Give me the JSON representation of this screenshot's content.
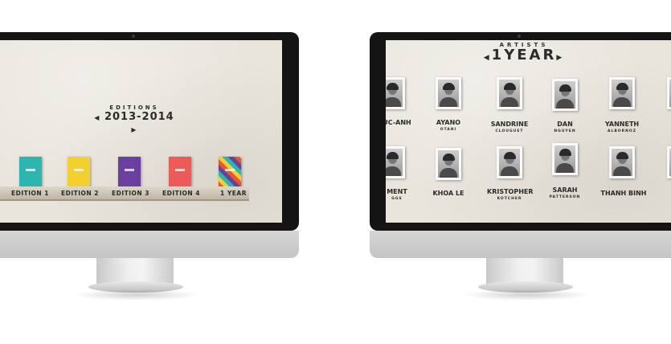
{
  "left_screen": {
    "heading_small": "EDITIONS",
    "heading_big": "2013-2014",
    "editions": [
      {
        "label": "EDITION 1",
        "color": "#2bb6b0"
      },
      {
        "label": "EDITION 2",
        "color": "#f3d02b"
      },
      {
        "label": "EDITION 3",
        "color": "#6a3fa0"
      },
      {
        "label": "EDITION 4",
        "color": "#ee5a57"
      },
      {
        "label": "1 YEAR",
        "color": "#e8552f"
      }
    ]
  },
  "right_screen": {
    "heading_small": "ARTISTS",
    "heading_big": "1YEAR",
    "artists_row1": [
      {
        "name": "UC-ANH",
        "sub": ""
      },
      {
        "name": "AYANO",
        "sub": "OTANI"
      },
      {
        "name": "SANDRINE",
        "sub": "CLOUGUET"
      },
      {
        "name": "DAN",
        "sub": "NGUYEN"
      },
      {
        "name": "YANNETH",
        "sub": "ALBORNOZ"
      }
    ],
    "artists_row2": [
      {
        "name": "MENT",
        "sub": "GGS"
      },
      {
        "name": "KHOA LE",
        "sub": ""
      },
      {
        "name": "KRISTOPHER",
        "sub": "KOTCHER"
      },
      {
        "name": "SARAH",
        "sub": "PATTERSON"
      },
      {
        "name": "THANH BINH",
        "sub": ""
      }
    ]
  }
}
